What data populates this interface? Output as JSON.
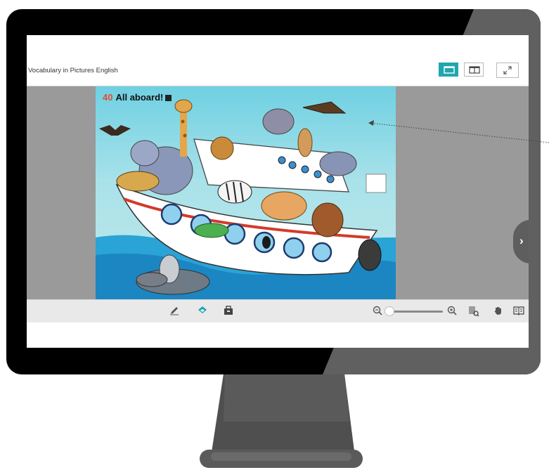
{
  "app": {
    "title": "Vocabulary in Pictures English"
  },
  "view_modes": [
    {
      "name": "single-page",
      "active": true
    },
    {
      "name": "two-page",
      "active": false
    }
  ],
  "page": {
    "number": "40",
    "heading": "All aboard!"
  },
  "toolbar": {
    "tools": [
      "pen-icon",
      "layers-icon",
      "toolbox-icon"
    ],
    "zoom_level": 0.05,
    "right_tools": [
      "thumbnail-search-icon",
      "hand-icon",
      "book-icon"
    ]
  },
  "colors": {
    "accent": "#1fa7b0",
    "page_number": "#e84a2e",
    "viewer_bg": "#9a9a9a",
    "monitor": "#000000"
  }
}
